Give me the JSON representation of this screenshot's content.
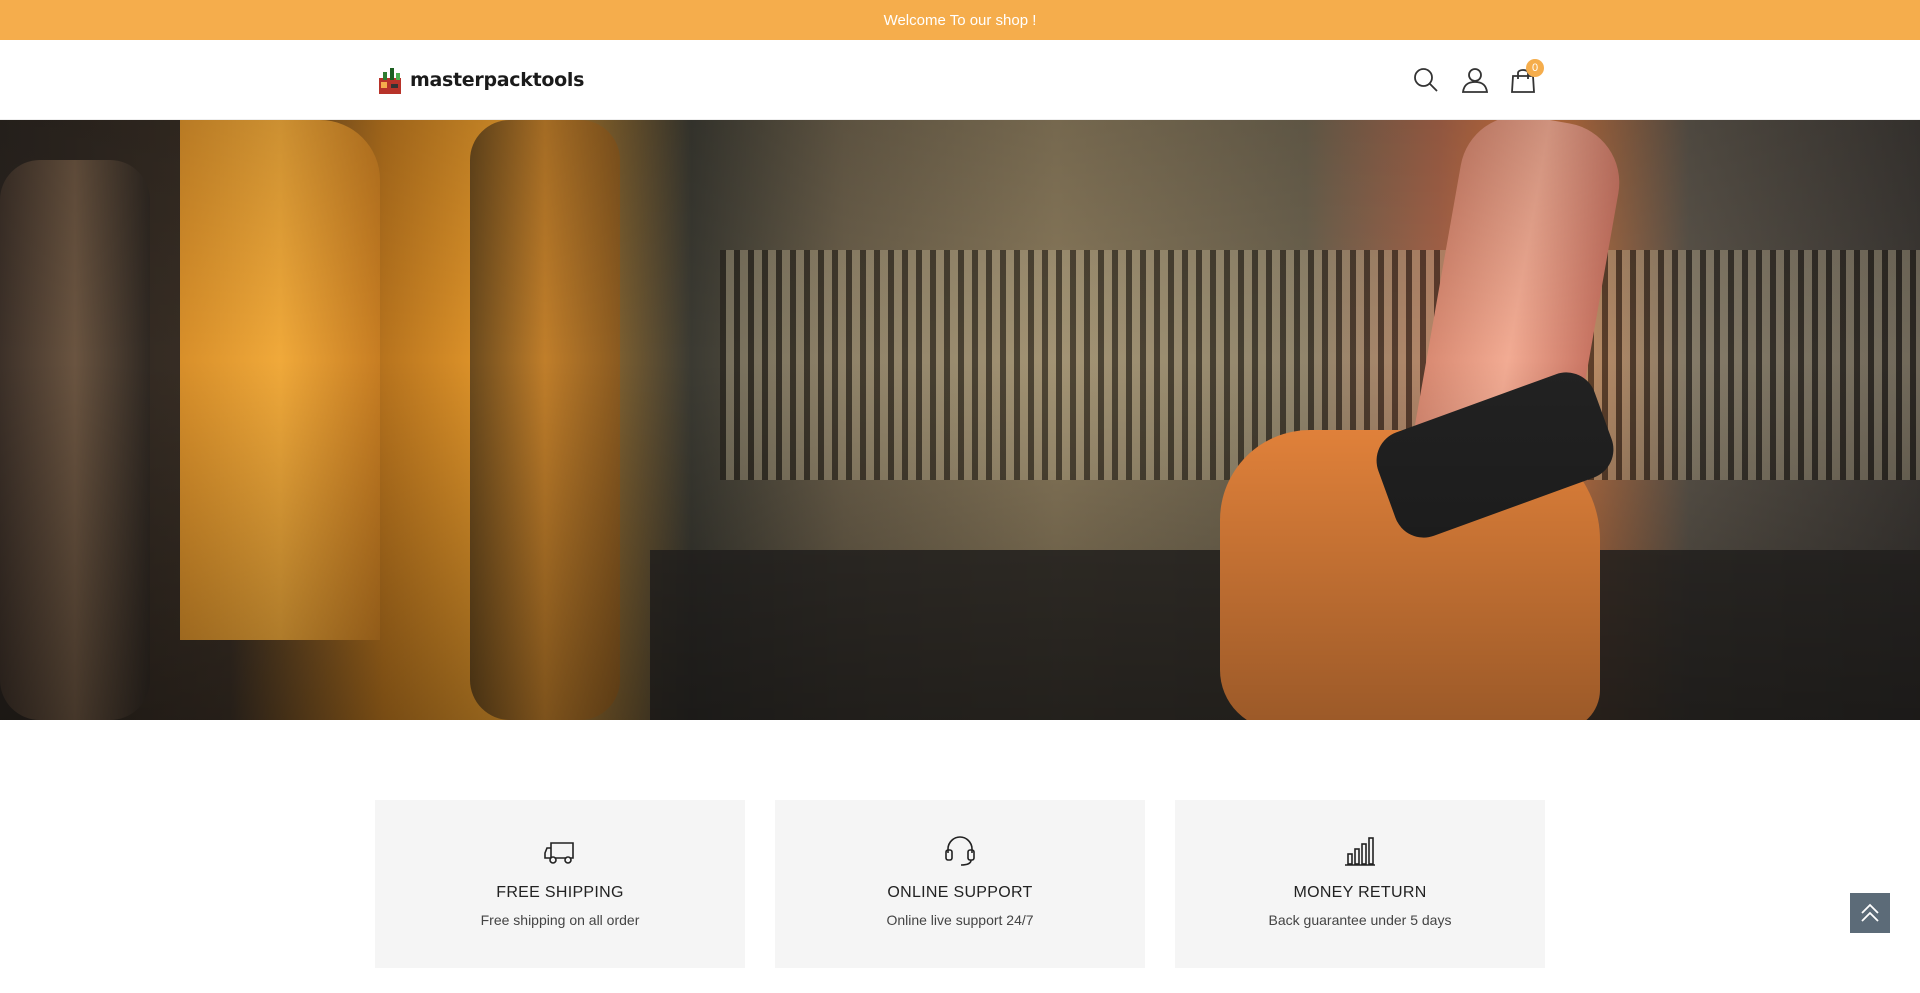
{
  "topbar": {
    "welcome_text": "Welcome To our shop !"
  },
  "header": {
    "logo_text": "masterpacktools",
    "icons": {
      "search": "search-icon",
      "account": "user-icon",
      "cart": "cart-icon"
    },
    "cart_count": "0"
  },
  "hero": {
    "image": "mechanic-engine-photo"
  },
  "features": [
    {
      "icon": "truck-icon",
      "title": "FREE SHIPPING",
      "description": "Free shipping on all order"
    },
    {
      "icon": "headset-icon",
      "title": "ONLINE SUPPORT",
      "description": "Online live support 24/7"
    },
    {
      "icon": "bar-chart-icon",
      "title": "MONEY RETURN",
      "description": "Back guarantee under 5 days"
    }
  ],
  "back_to_top": {
    "icon": "double-chevron-up-icon"
  },
  "colors": {
    "accent": "#f5ad4c",
    "feature_bg": "#f5f5f5",
    "back_to_top_bg": "#5c6b78"
  }
}
